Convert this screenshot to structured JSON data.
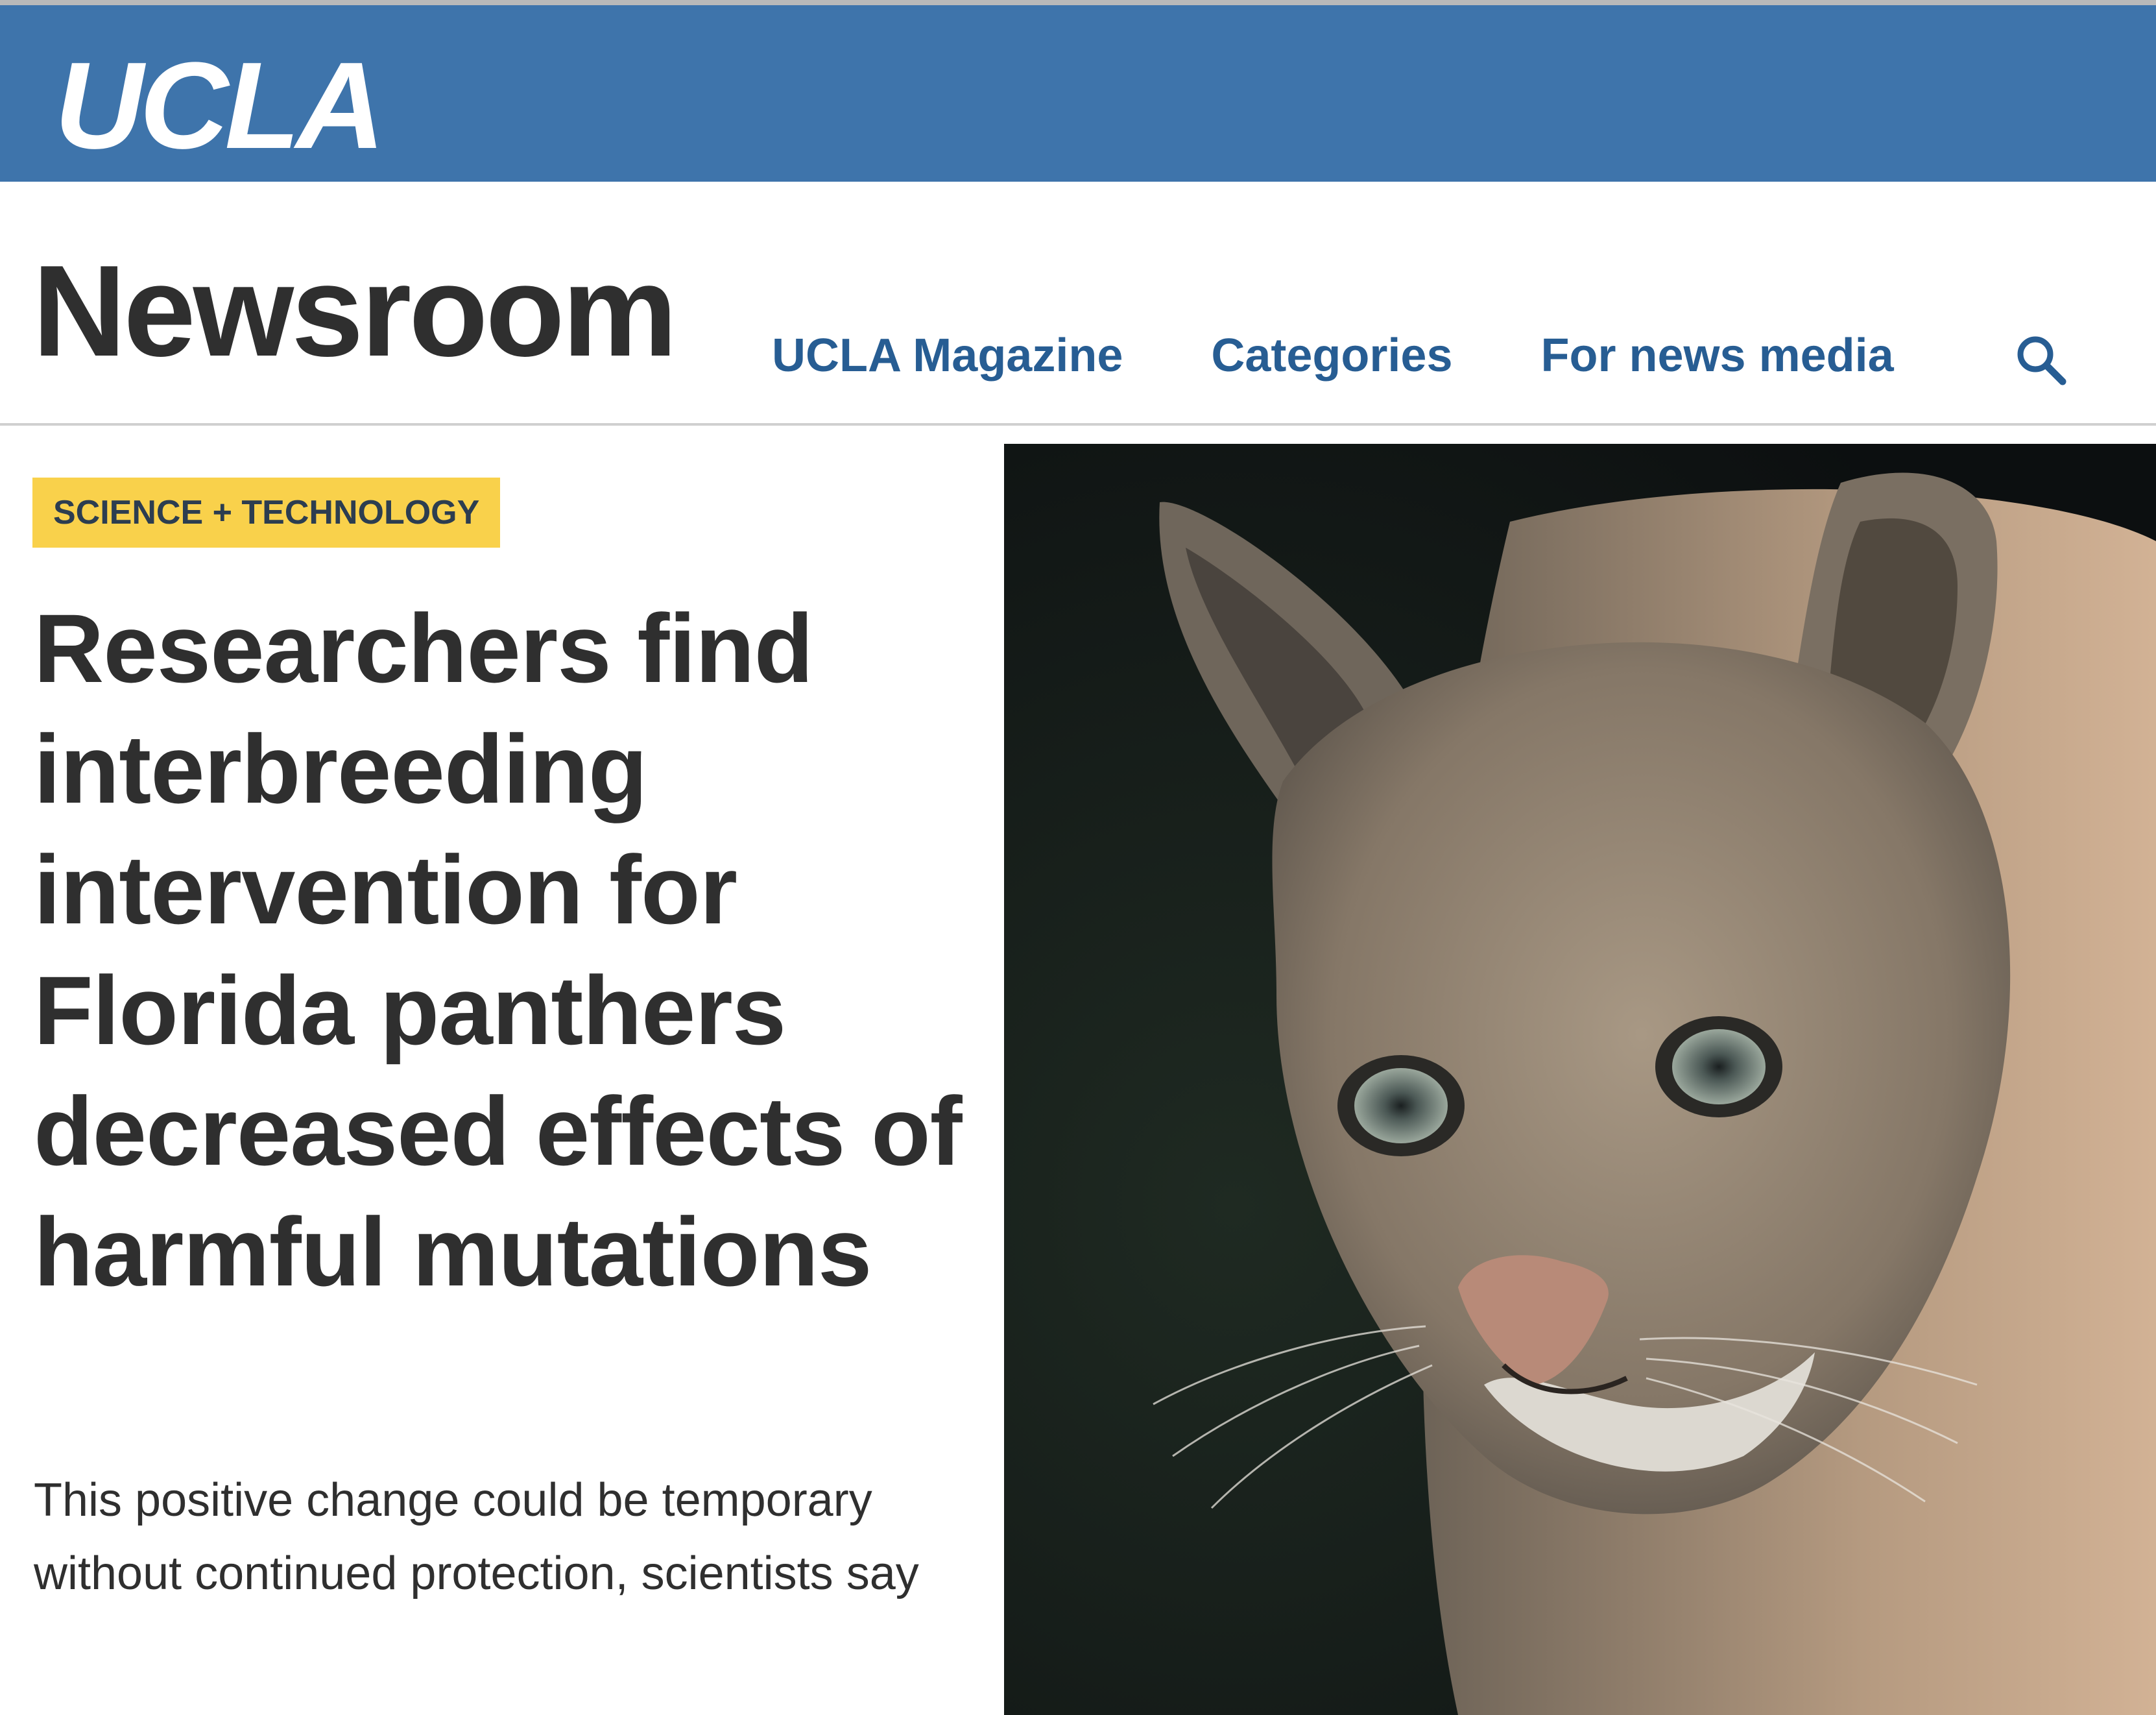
{
  "brand": {
    "logo_text": "UCLA"
  },
  "header": {
    "site_title": "Newsroom",
    "nav": [
      {
        "label": "UCLA Magazine"
      },
      {
        "label": "Categories"
      },
      {
        "label": "For news media"
      }
    ],
    "search_icon": "search-icon"
  },
  "article": {
    "category": "SCIENCE + TECHNOLOGY",
    "headline": "Researchers find interbreeding intervention for Florida panthers decreased effects of harmful mutations",
    "dek": "This positive change could be temporary without continued protection, scientists say",
    "image_subject": "florida-panther-photo"
  },
  "colors": {
    "brand_blue": "#3e74ab",
    "nav_blue": "#275d93",
    "badge_yellow": "#f9d14b",
    "text_dark": "#2f2f2f"
  }
}
